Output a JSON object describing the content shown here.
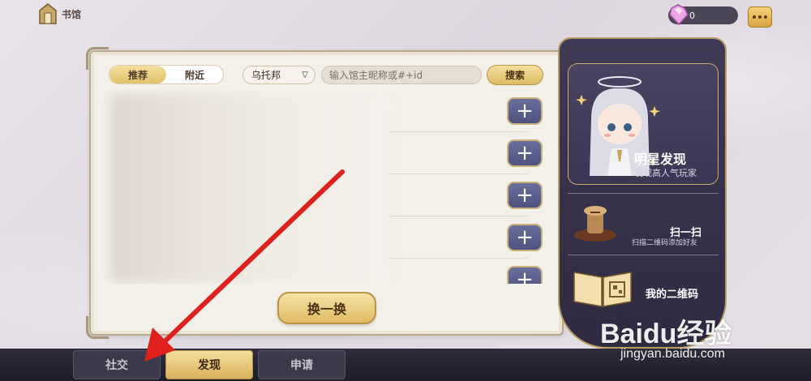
{
  "header": {
    "home_label": "书馆",
    "gem_count": "0"
  },
  "tabs": [
    {
      "label": "推荐",
      "active": true
    },
    {
      "label": "附近",
      "active": false
    }
  ],
  "region": {
    "value": "乌托邦"
  },
  "search": {
    "placeholder": "输入馆主昵称或#+id",
    "button_label": "搜索"
  },
  "list": {
    "rows": 5,
    "add_icon": "plus-icon"
  },
  "refresh_label": "换一换",
  "side": {
    "star_title": "明星发现",
    "star_sub": "发现高人气玩家",
    "scan_title": "扫一扫",
    "scan_sub": "扫描二维码添加好友",
    "qr_title": "我的二维码"
  },
  "bottom_nav": [
    {
      "label": "社交",
      "active": false
    },
    {
      "label": "发现",
      "active": true
    },
    {
      "label": "申请",
      "active": false
    }
  ],
  "watermark": {
    "logo": "Baidu经验",
    "url": "jingyan.baidu.com"
  },
  "colors": {
    "accent_gold": "#dfbb63",
    "panel_purple": "#3f3a55",
    "arrow_red": "#e0201c"
  }
}
